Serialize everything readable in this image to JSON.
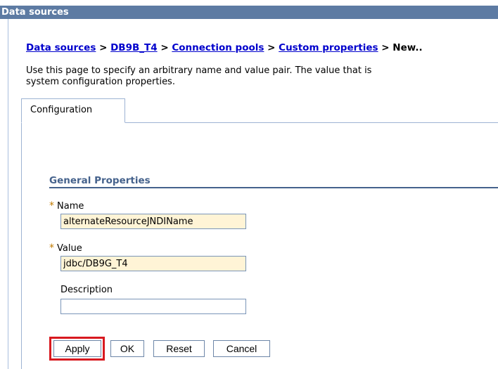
{
  "window": {
    "title": "Data sources"
  },
  "breadcrumb": {
    "items": [
      "Data sources",
      "DB9B_T4",
      "Connection pools",
      "Custom properties"
    ],
    "separator": ">",
    "current": "New.."
  },
  "description": {
    "line1": "Use this page to specify an arbitrary name and value pair. The value that is",
    "line2": "system configuration properties."
  },
  "tabs": [
    {
      "label": "Configuration",
      "active": true
    }
  ],
  "general_properties": {
    "title": "General Properties",
    "required_marker": "*",
    "name": {
      "label": "Name",
      "value": "alternateResourceJNDIName",
      "required": true
    },
    "value": {
      "label": "Value",
      "value": "jdbc/DB9G_T4",
      "required": true
    },
    "description": {
      "label": "Description",
      "value": "",
      "required": false
    }
  },
  "buttons": {
    "apply": "Apply",
    "ok": "OK",
    "reset": "Reset",
    "cancel": "Cancel"
  },
  "colors": {
    "titlebar": "#5d7ba3",
    "link": "#0000cc",
    "section_title": "#45628c",
    "required_field_bg": "#fff4d6",
    "highlight": "#d8191f"
  }
}
